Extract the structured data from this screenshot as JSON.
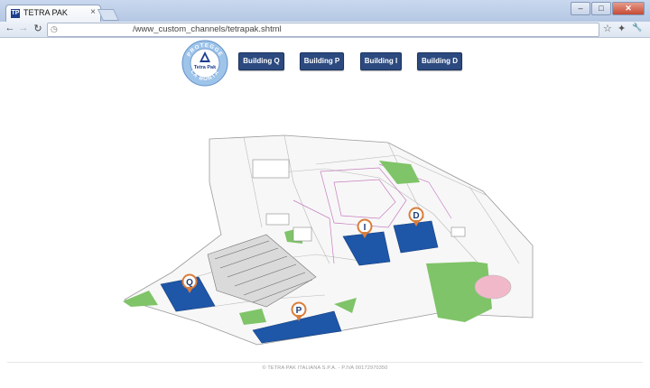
{
  "browser": {
    "tab_title": "TETRA PAK",
    "tab_favicon": "TP",
    "tab_close": "×",
    "url": "/www_custom_channels/tetrapak.shtml",
    "window_buttons": {
      "minimize": "–",
      "maximize": "□",
      "close": "✕"
    },
    "nav": {
      "back": "←",
      "forward": "→",
      "reload": "↻",
      "page_icon": "◷",
      "star": "☆",
      "extensions": "✦",
      "settings": "🔧"
    }
  },
  "header": {
    "logo": {
      "top_text": "PROTEGGE",
      "bottom_text": "LA BONTÀ",
      "brand": "Tetra Pak"
    },
    "buttons": [
      {
        "label": "Building Q"
      },
      {
        "label": "Building P"
      },
      {
        "label": "Building I"
      },
      {
        "label": "Building D"
      }
    ]
  },
  "map": {
    "markers": [
      {
        "label": "Q"
      },
      {
        "label": "P"
      },
      {
        "label": "I"
      },
      {
        "label": "D"
      }
    ],
    "colors": {
      "building": "#1e56a8",
      "pin": "#d97e3c",
      "green": "#7fc468",
      "pool": "#f1b8c9"
    }
  },
  "footer": {
    "text": "© TETRA PAK ITALIANA S.P.A. - P.IVA 00172970350"
  }
}
